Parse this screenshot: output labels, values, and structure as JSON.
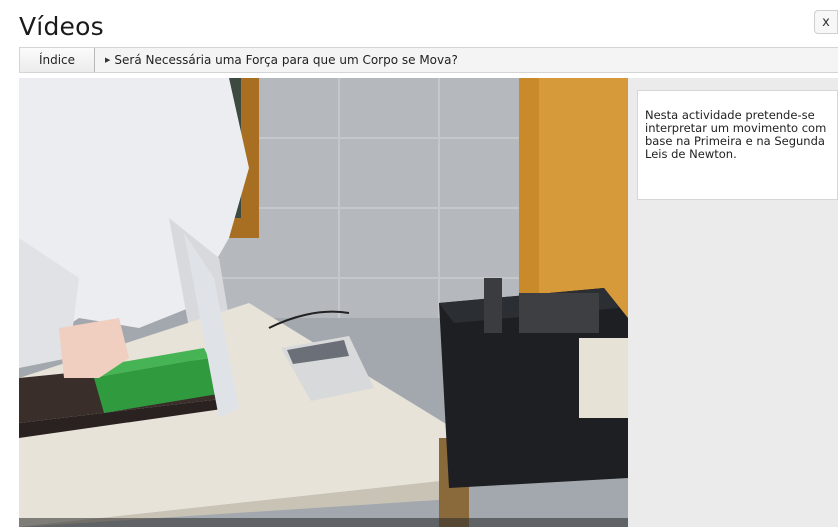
{
  "header": {
    "title": "Vídeos",
    "close_label": "x"
  },
  "navbar": {
    "index_label": "Índice",
    "current_label": "Será Necessária uma Força para que um Corpo se Mova?"
  },
  "info": {
    "text": "Nesta actividade pretende-se interpretar um movimento com base na Primeira e na Segunda Leis de Newton."
  },
  "video": {
    "content": "lab-experiment-video-frame"
  }
}
